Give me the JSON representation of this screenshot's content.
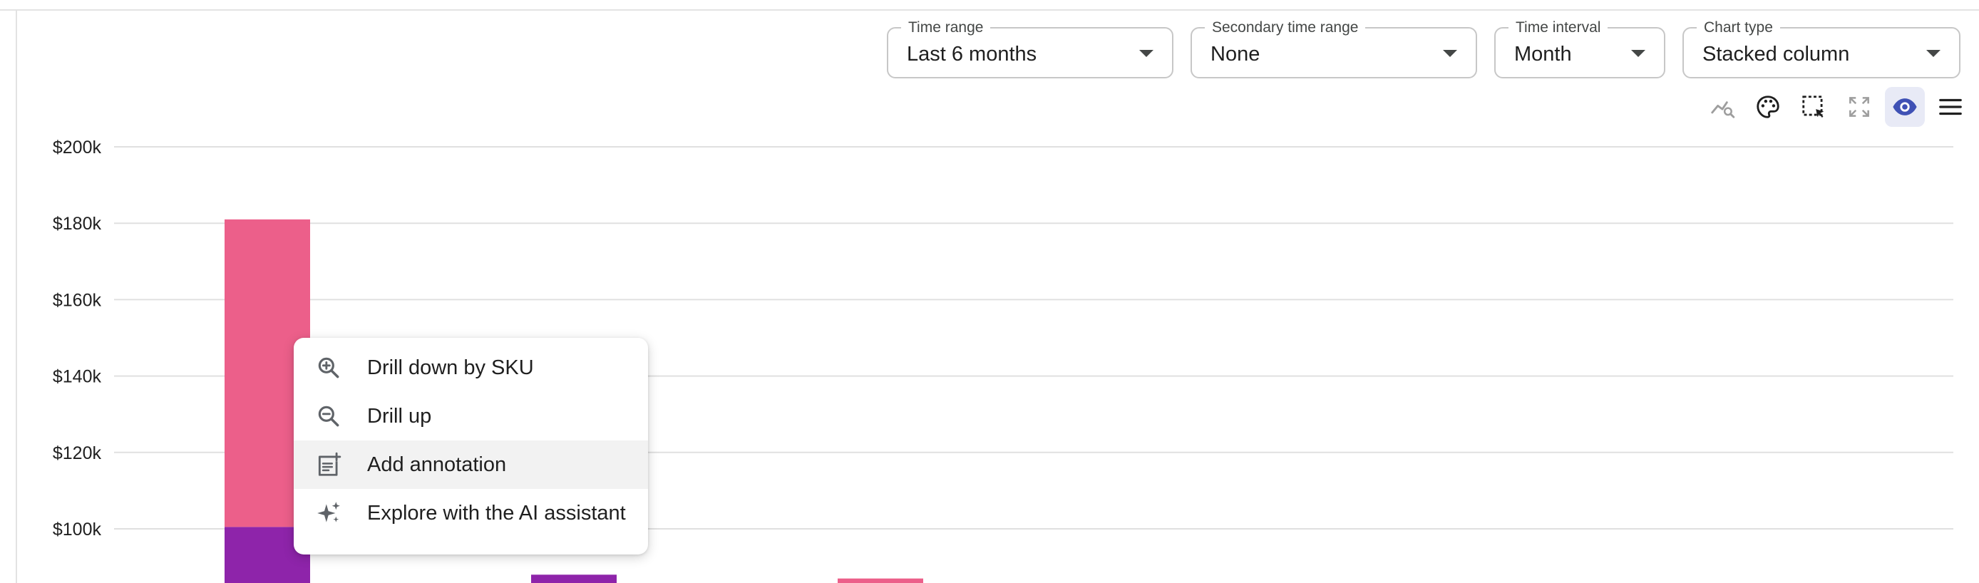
{
  "controls": {
    "time_range": {
      "label": "Time range",
      "value": "Last 6 months"
    },
    "secondary_time_range": {
      "label": "Secondary time range",
      "value": "None"
    },
    "time_interval": {
      "label": "Time interval",
      "value": "Month"
    },
    "chart_type": {
      "label": "Chart type",
      "value": "Stacked column"
    }
  },
  "toolbar": {
    "icons": [
      "insights-icon",
      "palette-icon",
      "select-region-icon",
      "fullscreen-icon",
      "visibility-icon",
      "menu-icon"
    ],
    "active": "visibility-icon"
  },
  "context_menu": {
    "items": [
      {
        "label": "Drill down by SKU",
        "icon": "zoom-in-icon"
      },
      {
        "label": "Drill up",
        "icon": "zoom-out-icon"
      },
      {
        "label": "Add annotation",
        "icon": "note-add-icon"
      },
      {
        "label": "Explore with the AI assistant",
        "icon": "sparkle-icon"
      }
    ],
    "hovered_index": 2
  },
  "chart_data": {
    "type": "bar",
    "stacked": true,
    "y_tick_labels": [
      "$200k",
      "$180k",
      "$160k",
      "$140k",
      "$120k",
      "$100k"
    ],
    "ylim": [
      85000,
      204000
    ],
    "grid": true,
    "series": [
      {
        "color": "#8e24aa",
        "values": [
          100500,
          88000,
          85000
        ]
      },
      {
        "color": "#ec5f8a",
        "values": [
          80500,
          0,
          2000
        ]
      }
    ]
  }
}
